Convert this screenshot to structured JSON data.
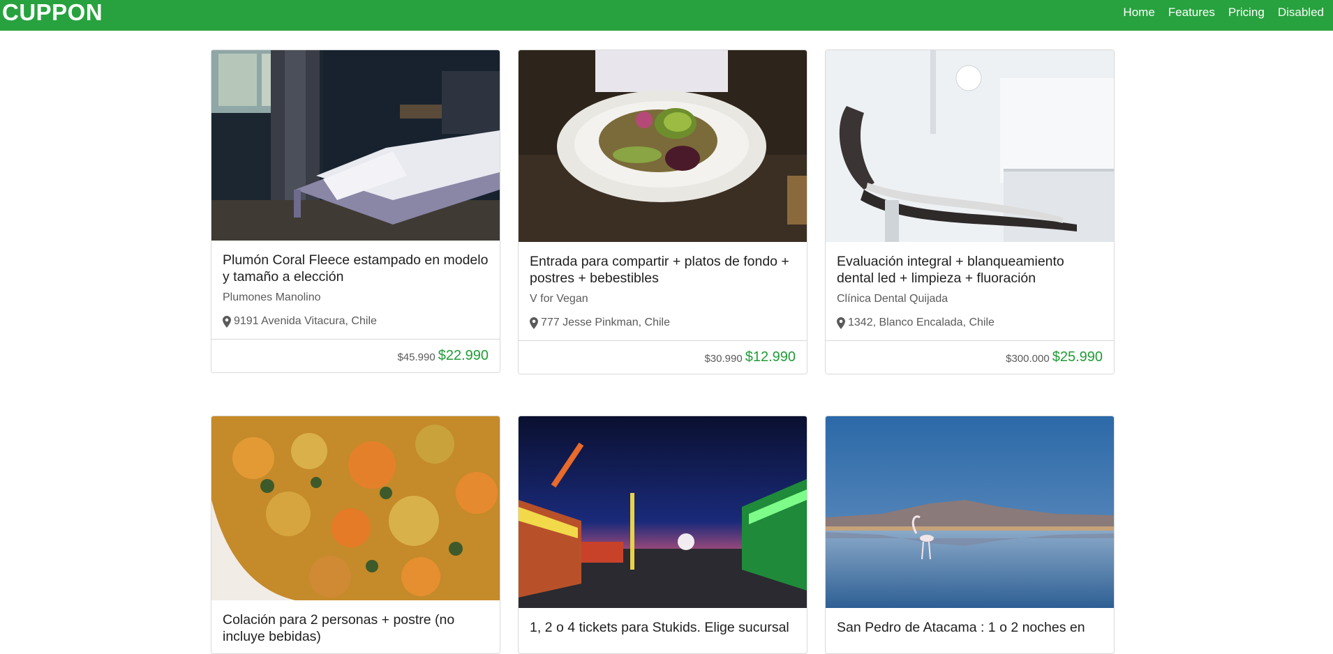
{
  "navbar": {
    "brand": "CUPPON",
    "links": [
      {
        "label": "Home"
      },
      {
        "label": "Features"
      },
      {
        "label": "Pricing"
      },
      {
        "label": "Disabled"
      }
    ]
  },
  "colors": {
    "navbar_bg": "#28a23f",
    "price_green": "#1e9c35"
  },
  "deals": [
    {
      "title": "Plumón Coral Fleece estampado en modelo y tamaño a elección",
      "merchant": "Plumones Manolino",
      "location": "9191 Avenida Vitacura, Chile",
      "old_price": "$45.990",
      "new_price": "$22.990",
      "image": "bedroom-photo"
    },
    {
      "title": "Entrada para compartir + platos de fondo + postres + bebestibles",
      "merchant": "V for Vegan",
      "location": "777 Jesse Pinkman, Chile",
      "old_price": "$30.990",
      "new_price": "$12.990",
      "image": "vegan-plate-photo"
    },
    {
      "title": "Evaluación integral + blanqueamiento dental led + limpieza + fluoración",
      "merchant": "Clínica Dental Quijada",
      "location": "1342, Blanco Encalada, Chile",
      "old_price": "$300.000",
      "new_price": "$25.990",
      "image": "dental-chair-photo"
    },
    {
      "title": "Colación para 2 personas + postre (no incluye bebidas)",
      "image": "food-dish-photo"
    },
    {
      "title": "1, 2 o 4 tickets para Stukids. Elige sucursal",
      "image": "fair-night-photo"
    },
    {
      "title": "San Pedro de Atacama : 1 o 2 noches en",
      "image": "flamingo-lake-photo"
    }
  ]
}
